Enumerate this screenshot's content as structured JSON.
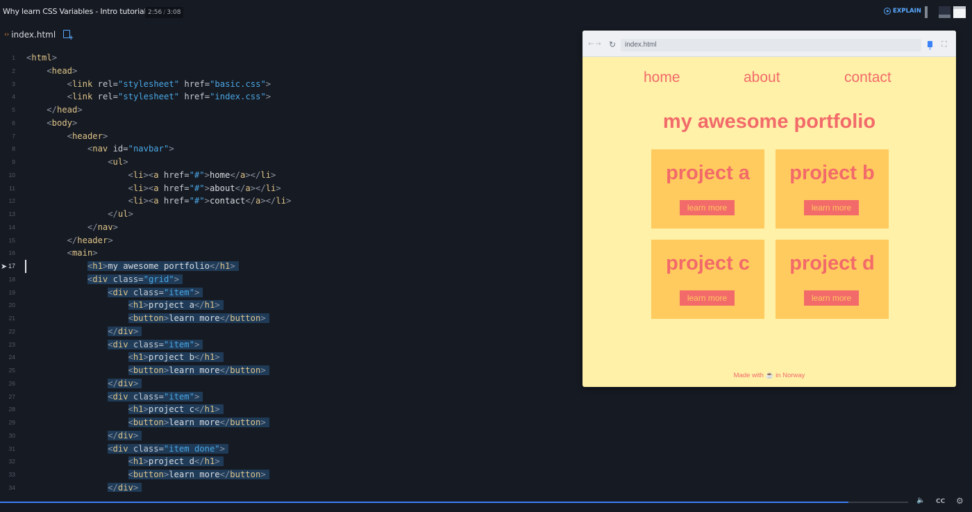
{
  "topbar": {
    "title": "Why learn CSS Variables - Intro tutorial",
    "time_current": "2:56",
    "time_total": "3:08",
    "explain_label": "EXPLAIN"
  },
  "editor": {
    "tab_label": "index.html",
    "active_line": 17,
    "lines": [
      {
        "n": "1",
        "indent": 0,
        "parts": [
          [
            "p",
            "<"
          ],
          [
            "tag",
            "html"
          ],
          [
            "p",
            ">"
          ]
        ]
      },
      {
        "n": "2",
        "indent": 1,
        "parts": [
          [
            "p",
            "<"
          ],
          [
            "tag",
            "head"
          ],
          [
            "p",
            ">"
          ]
        ]
      },
      {
        "n": "3",
        "indent": 2,
        "parts": [
          [
            "p",
            "<"
          ],
          [
            "tag",
            "link"
          ],
          [
            "attr",
            " rel="
          ],
          [
            "str",
            "\"stylesheet\""
          ],
          [
            "attr",
            " href="
          ],
          [
            "str",
            "\"basic.css\""
          ],
          [
            "p",
            ">"
          ]
        ]
      },
      {
        "n": "4",
        "indent": 2,
        "parts": [
          [
            "p",
            "<"
          ],
          [
            "tag",
            "link"
          ],
          [
            "attr",
            " rel="
          ],
          [
            "str",
            "\"stylesheet\""
          ],
          [
            "attr",
            " href="
          ],
          [
            "str",
            "\"index.css\""
          ],
          [
            "p",
            ">"
          ]
        ]
      },
      {
        "n": "5",
        "indent": 1,
        "parts": [
          [
            "p",
            "</"
          ],
          [
            "tag",
            "head"
          ],
          [
            "p",
            ">"
          ]
        ]
      },
      {
        "n": "6",
        "indent": 1,
        "parts": [
          [
            "p",
            "<"
          ],
          [
            "tag",
            "body"
          ],
          [
            "p",
            ">"
          ]
        ]
      },
      {
        "n": "7",
        "indent": 2,
        "parts": [
          [
            "p",
            "<"
          ],
          [
            "tag",
            "header"
          ],
          [
            "p",
            ">"
          ]
        ]
      },
      {
        "n": "8",
        "indent": 3,
        "parts": [
          [
            "p",
            "<"
          ],
          [
            "tag",
            "nav"
          ],
          [
            "attr",
            " id="
          ],
          [
            "str",
            "\"navbar\""
          ],
          [
            "p",
            ">"
          ]
        ]
      },
      {
        "n": "9",
        "indent": 4,
        "parts": [
          [
            "p",
            "<"
          ],
          [
            "tag",
            "ul"
          ],
          [
            "p",
            ">"
          ]
        ]
      },
      {
        "n": "10",
        "indent": 5,
        "parts": [
          [
            "p",
            "<"
          ],
          [
            "tag",
            "li"
          ],
          [
            "p",
            "><"
          ],
          [
            "tag",
            "a"
          ],
          [
            "attr",
            " href="
          ],
          [
            "str",
            "\"#\""
          ],
          [
            "p",
            ">"
          ],
          [
            "txt",
            "home"
          ],
          [
            "p",
            "</"
          ],
          [
            "tag",
            "a"
          ],
          [
            "p",
            "></"
          ],
          [
            "tag",
            "li"
          ],
          [
            "p",
            ">"
          ]
        ]
      },
      {
        "n": "11",
        "indent": 5,
        "parts": [
          [
            "p",
            "<"
          ],
          [
            "tag",
            "li"
          ],
          [
            "p",
            "><"
          ],
          [
            "tag",
            "a"
          ],
          [
            "attr",
            " href="
          ],
          [
            "str",
            "\"#\""
          ],
          [
            "p",
            ">"
          ],
          [
            "txt",
            "about"
          ],
          [
            "p",
            "</"
          ],
          [
            "tag",
            "a"
          ],
          [
            "p",
            "></"
          ],
          [
            "tag",
            "li"
          ],
          [
            "p",
            ">"
          ]
        ]
      },
      {
        "n": "12",
        "indent": 5,
        "parts": [
          [
            "p",
            "<"
          ],
          [
            "tag",
            "li"
          ],
          [
            "p",
            "><"
          ],
          [
            "tag",
            "a"
          ],
          [
            "attr",
            " href="
          ],
          [
            "str",
            "\"#\""
          ],
          [
            "p",
            ">"
          ],
          [
            "txt",
            "contact"
          ],
          [
            "p",
            "</"
          ],
          [
            "tag",
            "a"
          ],
          [
            "p",
            "></"
          ],
          [
            "tag",
            "li"
          ],
          [
            "p",
            ">"
          ]
        ]
      },
      {
        "n": "13",
        "indent": 4,
        "parts": [
          [
            "p",
            "</"
          ],
          [
            "tag",
            "ul"
          ],
          [
            "p",
            ">"
          ]
        ]
      },
      {
        "n": "14",
        "indent": 3,
        "parts": [
          [
            "p",
            "</"
          ],
          [
            "tag",
            "nav"
          ],
          [
            "p",
            ">"
          ]
        ]
      },
      {
        "n": "15",
        "indent": 2,
        "parts": [
          [
            "p",
            "</"
          ],
          [
            "tag",
            "header"
          ],
          [
            "p",
            ">"
          ]
        ]
      },
      {
        "n": "16",
        "indent": 2,
        "parts": [
          [
            "p",
            "<"
          ],
          [
            "tag",
            "main"
          ],
          [
            "p",
            ">"
          ]
        ]
      },
      {
        "n": "17",
        "indent": 3,
        "sel": true,
        "parts": [
          [
            "p",
            "<"
          ],
          [
            "tag",
            "h1"
          ],
          [
            "p",
            ">"
          ],
          [
            "txt",
            "my awesome portfolio"
          ],
          [
            "p",
            "</"
          ],
          [
            "tag",
            "h1"
          ],
          [
            "p",
            ">"
          ]
        ]
      },
      {
        "n": "18",
        "indent": 3,
        "sel": true,
        "parts": [
          [
            "p",
            "<"
          ],
          [
            "tag",
            "div"
          ],
          [
            "attr",
            " class="
          ],
          [
            "str",
            "\"grid\""
          ],
          [
            "p",
            ">"
          ]
        ]
      },
      {
        "n": "19",
        "indent": 4,
        "sel": true,
        "parts": [
          [
            "p",
            "<"
          ],
          [
            "tag",
            "div"
          ],
          [
            "attr",
            " class="
          ],
          [
            "str",
            "\"item\""
          ],
          [
            "p",
            ">"
          ]
        ]
      },
      {
        "n": "20",
        "indent": 5,
        "sel": true,
        "parts": [
          [
            "p",
            "<"
          ],
          [
            "tag",
            "h1"
          ],
          [
            "p",
            ">"
          ],
          [
            "txt",
            "project a"
          ],
          [
            "p",
            "</"
          ],
          [
            "tag",
            "h1"
          ],
          [
            "p",
            ">"
          ]
        ]
      },
      {
        "n": "21",
        "indent": 5,
        "sel": true,
        "parts": [
          [
            "p",
            "<"
          ],
          [
            "tag",
            "button"
          ],
          [
            "p",
            ">"
          ],
          [
            "txt",
            "learn more"
          ],
          [
            "p",
            "</"
          ],
          [
            "tag",
            "button"
          ],
          [
            "p",
            ">"
          ]
        ]
      },
      {
        "n": "22",
        "indent": 4,
        "sel": true,
        "parts": [
          [
            "p",
            "</"
          ],
          [
            "tag",
            "div"
          ],
          [
            "p",
            ">"
          ]
        ]
      },
      {
        "n": "23",
        "indent": 4,
        "sel": true,
        "parts": [
          [
            "p",
            "<"
          ],
          [
            "tag",
            "div"
          ],
          [
            "attr",
            " class="
          ],
          [
            "str",
            "\"item\""
          ],
          [
            "p",
            ">"
          ]
        ]
      },
      {
        "n": "24",
        "indent": 5,
        "sel": true,
        "parts": [
          [
            "p",
            "<"
          ],
          [
            "tag",
            "h1"
          ],
          [
            "p",
            ">"
          ],
          [
            "txt",
            "project b"
          ],
          [
            "p",
            "</"
          ],
          [
            "tag",
            "h1"
          ],
          [
            "p",
            ">"
          ]
        ]
      },
      {
        "n": "25",
        "indent": 5,
        "sel": true,
        "parts": [
          [
            "p",
            "<"
          ],
          [
            "tag",
            "button"
          ],
          [
            "p",
            ">"
          ],
          [
            "txt",
            "learn more"
          ],
          [
            "p",
            "</"
          ],
          [
            "tag",
            "button"
          ],
          [
            "p",
            ">"
          ]
        ]
      },
      {
        "n": "26",
        "indent": 4,
        "sel": true,
        "parts": [
          [
            "p",
            "</"
          ],
          [
            "tag",
            "div"
          ],
          [
            "p",
            ">"
          ]
        ]
      },
      {
        "n": "27",
        "indent": 4,
        "sel": true,
        "parts": [
          [
            "p",
            "<"
          ],
          [
            "tag",
            "div"
          ],
          [
            "attr",
            " class="
          ],
          [
            "str",
            "\"item\""
          ],
          [
            "p",
            ">"
          ]
        ]
      },
      {
        "n": "28",
        "indent": 5,
        "sel": true,
        "parts": [
          [
            "p",
            "<"
          ],
          [
            "tag",
            "h1"
          ],
          [
            "p",
            ">"
          ],
          [
            "txt",
            "project c"
          ],
          [
            "p",
            "</"
          ],
          [
            "tag",
            "h1"
          ],
          [
            "p",
            ">"
          ]
        ]
      },
      {
        "n": "29",
        "indent": 5,
        "sel": true,
        "parts": [
          [
            "p",
            "<"
          ],
          [
            "tag",
            "button"
          ],
          [
            "p",
            ">"
          ],
          [
            "txt",
            "learn more"
          ],
          [
            "p",
            "</"
          ],
          [
            "tag",
            "button"
          ],
          [
            "p",
            ">"
          ]
        ]
      },
      {
        "n": "30",
        "indent": 4,
        "sel": true,
        "parts": [
          [
            "p",
            "</"
          ],
          [
            "tag",
            "div"
          ],
          [
            "p",
            ">"
          ]
        ]
      },
      {
        "n": "31",
        "indent": 4,
        "sel": true,
        "parts": [
          [
            "p",
            "<"
          ],
          [
            "tag",
            "div"
          ],
          [
            "attr",
            " class="
          ],
          [
            "str",
            "\"item done\""
          ],
          [
            "p",
            ">"
          ]
        ]
      },
      {
        "n": "32",
        "indent": 5,
        "sel": true,
        "parts": [
          [
            "p",
            "<"
          ],
          [
            "tag",
            "h1"
          ],
          [
            "p",
            ">"
          ],
          [
            "txt",
            "project d"
          ],
          [
            "p",
            "</"
          ],
          [
            "tag",
            "h1"
          ],
          [
            "p",
            ">"
          ]
        ]
      },
      {
        "n": "33",
        "indent": 5,
        "sel": true,
        "parts": [
          [
            "p",
            "<"
          ],
          [
            "tag",
            "button"
          ],
          [
            "p",
            ">"
          ],
          [
            "txt",
            "learn more"
          ],
          [
            "p",
            "</"
          ],
          [
            "tag",
            "button"
          ],
          [
            "p",
            ">"
          ]
        ]
      },
      {
        "n": "34",
        "indent": 4,
        "sel": true,
        "parts": [
          [
            "p",
            "</"
          ],
          [
            "tag",
            "div"
          ],
          [
            "p",
            ">"
          ]
        ]
      }
    ]
  },
  "preview": {
    "url": "index.html",
    "nav_links": [
      "home",
      "about",
      "contact"
    ],
    "heading": "my awesome portfolio",
    "projects": [
      {
        "title": "project a",
        "button": "learn more"
      },
      {
        "title": "project b",
        "button": "learn more"
      },
      {
        "title": "project c",
        "button": "learn more"
      },
      {
        "title": "project d",
        "button": "learn more"
      }
    ],
    "footer": "Made with ☕ in Norway"
  },
  "player": {
    "progress": 0.934,
    "cc_label": "CC"
  },
  "colors": {
    "accent": "#3b82f6",
    "preview_bg": "#fff1a8",
    "card_bg": "#ffcb5e",
    "coral": "#f26a6a",
    "selection": "#1f3b58"
  }
}
